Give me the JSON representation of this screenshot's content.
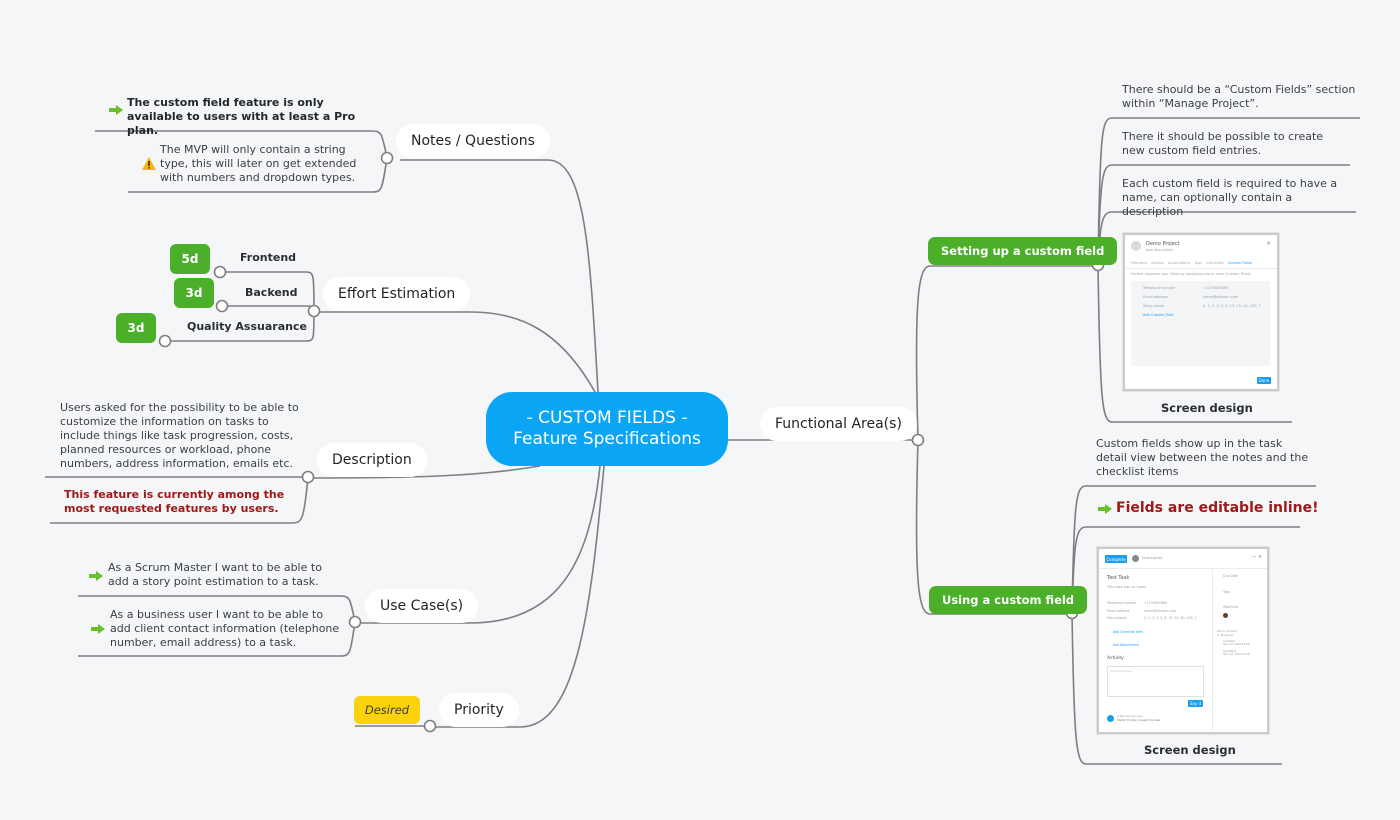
{
  "central": {
    "line1": "- CUSTOM FIELDS -",
    "line2": "Feature Specifications",
    "color": "#0aa6f5"
  },
  "topics": {
    "notes": {
      "label": "Notes / Questions",
      "items": [
        {
          "icon": "arrow-right-icon",
          "text": "The custom field feature is only available to users with at least a Pro plan."
        },
        {
          "icon": "warning-icon",
          "text": "The MVP will only contain a string type, this will later on get extended with numbers and dropdown types."
        }
      ]
    },
    "effort": {
      "label": "Effort Estimation",
      "items": [
        {
          "label": "Frontend",
          "estimate": "5d"
        },
        {
          "label": "Backend",
          "estimate": "3d"
        },
        {
          "label": "Quality Assuarance",
          "estimate": "3d"
        }
      ]
    },
    "description": {
      "label": "Description",
      "text": "Users asked for the possibility to be able to customize the information on tasks to include things like task progression, costs, planned resources or workload, phone numbers, address information, emails etc.",
      "highlight": "This feature is currently among the most requested features by users."
    },
    "use_cases": {
      "label": "Use Case(s)",
      "items": [
        {
          "icon": "arrow-right-icon",
          "text": "As a Scrum Master I want to be able to add a story point estimation to a task."
        },
        {
          "icon": "arrow-right-icon",
          "text": "As a business user I want to be able to add client contact information (telephone number, email address) to a task."
        }
      ]
    },
    "priority": {
      "label": "Priority",
      "value": "Desired"
    },
    "functional": {
      "label": "Functional Area(s)",
      "setup": {
        "label": "Setting up a custom field",
        "items": [
          "There should be a “Custom Fields” section within “Manage Project”.",
          "There it should be possible to create new custom field entries.",
          "Each custom field is required to have a name, can optionally contain a description"
        ],
        "caption": "Screen design",
        "mock": {
          "title": "Demo Project",
          "subtitle": "Add description",
          "tabs": [
            "Members",
            "Actions",
            "Automations",
            "Tags",
            "Checklists",
            "Custom Fields"
          ],
          "hint": "Further organize your Tasks by assigning one or more Custom Fields.",
          "rows": [
            {
              "name": "Telephone number",
              "value": "+1234567890"
            },
            {
              "name": "Email address",
              "value": "name@domain.com"
            },
            {
              "name": "Story points",
              "value": "0, 1, 2, 3, 5, 8, 13, 20, 40, 100, ?"
            }
          ],
          "add_label": "Add Custom Field",
          "done_label": "Done"
        }
      },
      "using": {
        "label": "Using a custom field",
        "note": "Custom fields show up in the task detail view between the notes and the checklist items",
        "highlight": "Fields are editable inline!",
        "caption": "Screen design",
        "mock": {
          "complete_label": "Complete",
          "assignee": "Unassigned",
          "task_title": "Test Task",
          "notes": "This task has no notes",
          "fields": [
            {
              "name": "Telephone number",
              "value": "+1234567890"
            },
            {
              "name": "Email address",
              "value": "name@domain.com"
            },
            {
              "name": "Story points",
              "value": "0, 1, 2, 3, 5, 8, 13, 20, 40, 100, ?"
            }
          ],
          "add_checklist": "Add Checklist Item",
          "add_attachment": "Add Attachment",
          "activity": "Activity",
          "comment_placeholder": "Post Comment",
          "say_it": "Say it",
          "activity_item": "Stefan Forster created the task",
          "activity_time": "a few seconds ago",
          "side": {
            "due_date": "Due Date",
            "tags": "Tags",
            "watching": "Watching",
            "project": "Demo Project",
            "status": "In Progress",
            "created": "Created",
            "created_date": "Mar 1st, 2018 14:08",
            "updated": "Updated",
            "updated_date": "Mar 1st, 2018 14:08"
          }
        }
      }
    }
  },
  "colors": {
    "accent_blue": "#0aa6f5",
    "green": "#4caf2a",
    "yellow": "#fcd20d",
    "red_text": "#a01818",
    "background": "#f5f6f8"
  }
}
